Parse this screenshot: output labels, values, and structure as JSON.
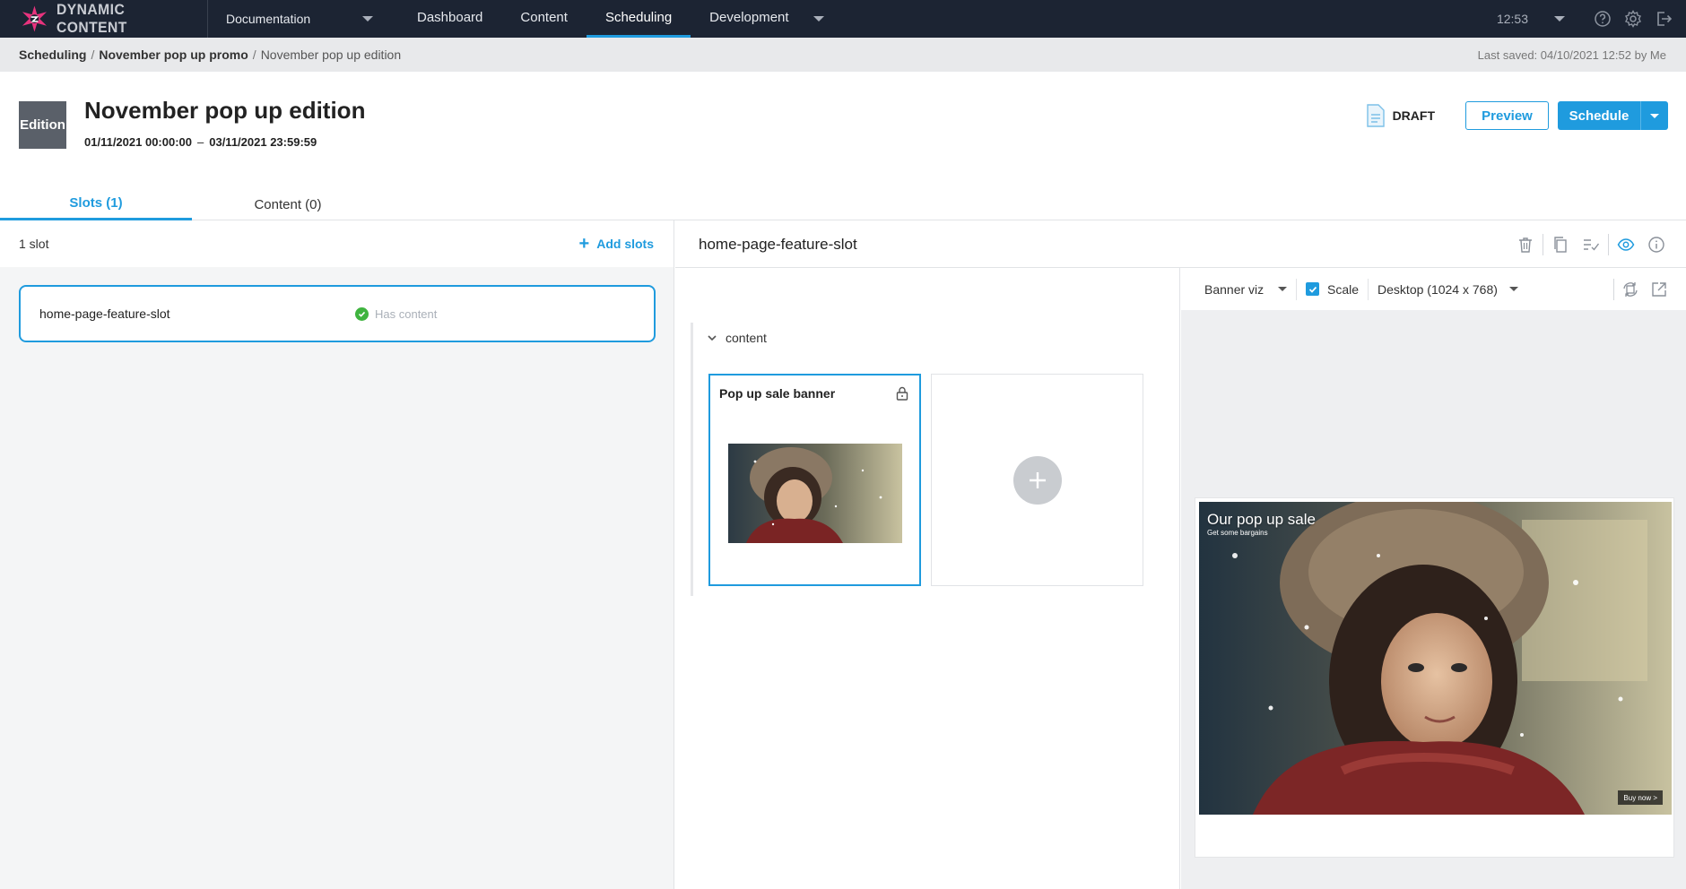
{
  "brand": {
    "name": "DYNAMIC CONTENT"
  },
  "hub": {
    "label": "Documentation"
  },
  "nav": {
    "tabs": [
      {
        "label": "Dashboard",
        "active": false
      },
      {
        "label": "Content",
        "active": false
      },
      {
        "label": "Scheduling",
        "active": true
      },
      {
        "label": "Development",
        "active": false
      }
    ],
    "time": "12:53",
    "icons": [
      "help-icon",
      "settings-icon",
      "logout-icon"
    ]
  },
  "breadcrumb": {
    "items": [
      "Scheduling",
      "November pop up promo",
      "November pop up edition"
    ],
    "last_saved": "Last saved: 04/10/2021 12:52 by Me"
  },
  "edition": {
    "badge": "Edition",
    "title": "November pop up edition",
    "start": "01/11/2021 00:00:00",
    "separator": "–",
    "end": "03/11/2021 23:59:59",
    "status": "DRAFT"
  },
  "actions": {
    "preview": "Preview",
    "schedule": "Schedule"
  },
  "tabs": [
    {
      "label": "Slots (1)",
      "active": true
    },
    {
      "label": "Content (0)",
      "active": false
    }
  ],
  "slots_panel": {
    "count": "1 slot",
    "add_label": "Add slots",
    "slots": [
      {
        "name": "home-page-feature-slot",
        "status": "Has content"
      }
    ]
  },
  "editor": {
    "slot_title": "home-page-feature-slot",
    "section_label": "content",
    "cards": [
      {
        "title": "Pop up sale banner",
        "locked": true
      }
    ]
  },
  "preview": {
    "visualization": "Banner viz",
    "scale_label": "Scale",
    "scale_checked": true,
    "device": "Desktop (1024 x 768)",
    "banner": {
      "headline": "Our pop up sale",
      "subline": "Get some bargains",
      "cta": "Buy now >"
    }
  },
  "colors": {
    "accent": "#1f9bde",
    "nav_bg": "#1c2433",
    "success": "#3fb43f",
    "logo": "#e8337e"
  }
}
